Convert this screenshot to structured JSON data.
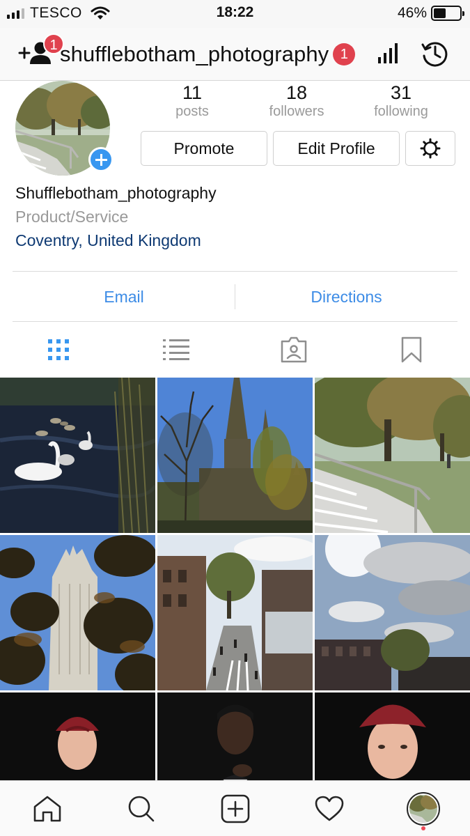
{
  "status_bar": {
    "carrier": "TESCO",
    "time": "18:22",
    "battery_percent_text": "46%",
    "battery_level": 0.46
  },
  "header": {
    "discover_badge": "1",
    "username": "shufflebotham_photography",
    "username_badge": "1",
    "icons": [
      "add-person-icon",
      "insights-icon",
      "archive-icon"
    ]
  },
  "profile": {
    "stats": {
      "posts": {
        "value": "11",
        "label": "posts"
      },
      "followers": {
        "value": "18",
        "label": "followers"
      },
      "following": {
        "value": "31",
        "label": "following"
      }
    },
    "buttons": {
      "promote": "Promote",
      "edit_profile": "Edit Profile"
    },
    "display_name": "Shufflebotham_photography",
    "category": "Product/Service",
    "location": "Coventry, United Kingdom"
  },
  "contact": {
    "email": "Email",
    "directions": "Directions"
  },
  "tabs": [
    "grid-icon",
    "list-icon",
    "tagged-icon",
    "saved-icon"
  ],
  "active_tab": "grid",
  "grid": {
    "photos": [
      "swans-on-lake",
      "cathedral-spire",
      "park-steps",
      "tower-through-leaves",
      "precinct-street",
      "cloudy-sky-rooftops",
      "man-in-red-cap",
      "man-in-black-jacket",
      "man-in-red-cap-closeup"
    ]
  },
  "bottom_nav": [
    "home-icon",
    "search-icon",
    "new-post-icon",
    "activity-icon",
    "profile-avatar"
  ],
  "colors": {
    "accent_blue": "#3897f0",
    "link_blue": "#3d8ce6",
    "location_blue": "#0f3a73",
    "badge_red": "#e0424e",
    "notification_dot": "#ed4956"
  }
}
